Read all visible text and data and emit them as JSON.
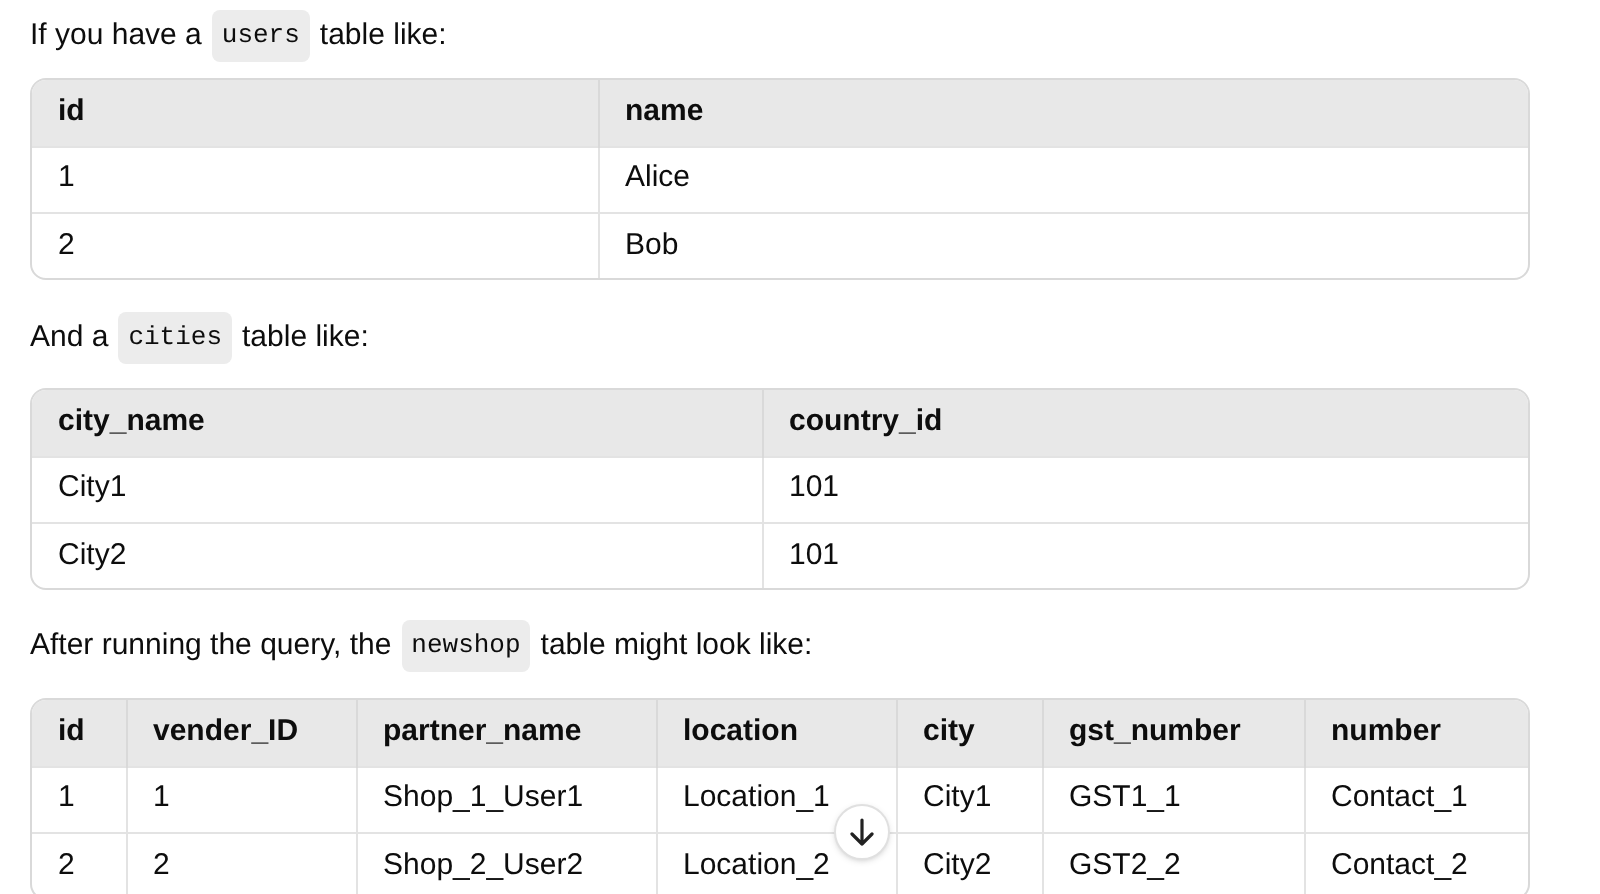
{
  "blocks": [
    {
      "kind": "paragraph",
      "parts": [
        {
          "kind": "text",
          "text": "If you have a"
        },
        {
          "kind": "code",
          "text": "users"
        },
        {
          "kind": "text",
          "text": "table like:"
        }
      ]
    },
    {
      "kind": "table",
      "columns": [
        "id",
        "name"
      ],
      "rows": [
        [
          "1",
          "Alice"
        ],
        [
          "2",
          "Bob"
        ]
      ]
    },
    {
      "kind": "paragraph",
      "parts": [
        {
          "kind": "text",
          "text": "And a"
        },
        {
          "kind": "code",
          "text": "cities"
        },
        {
          "kind": "text",
          "text": "table like:"
        }
      ]
    },
    {
      "kind": "table",
      "columns": [
        "city_name",
        "country_id"
      ],
      "rows": [
        [
          "City1",
          "101"
        ],
        [
          "City2",
          "101"
        ]
      ]
    },
    {
      "kind": "paragraph",
      "parts": [
        {
          "kind": "text",
          "text": "After running the query, the"
        },
        {
          "kind": "code",
          "text": "newshop"
        },
        {
          "kind": "text",
          "text": "table might look like:"
        }
      ]
    },
    {
      "kind": "table",
      "columns": [
        "id",
        "vender_ID",
        "partner_name",
        "location",
        "city",
        "gst_number",
        "number"
      ],
      "rows": [
        [
          "1",
          "1",
          "Shop_1_User1",
          "Location_1",
          "City1",
          "GST1_1",
          "Contact_1"
        ],
        [
          "2",
          "2",
          "Shop_2_User2",
          "Location_2",
          "City2",
          "GST2_2",
          "Contact_2"
        ]
      ]
    }
  ]
}
